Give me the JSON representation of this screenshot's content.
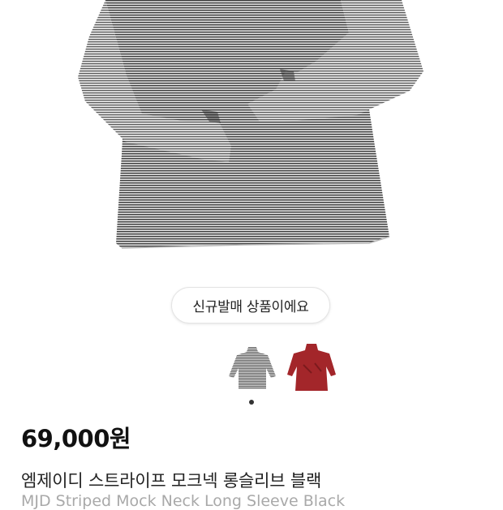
{
  "product": {
    "badge_label": "신규발매 상품이에요",
    "price": "69,000원",
    "name_ko": "엠제이디 스트라이프 모크넥 롱슬리브 블랙",
    "name_en": "MJD Striped Mock Neck Long Sleeve Black",
    "thumbnails": [
      {
        "name": "grey striped mock neck",
        "color": "#8a8a8a",
        "selected": true
      },
      {
        "name": "red mock neck",
        "color": "#a3262a",
        "selected": false
      }
    ]
  },
  "colors": {
    "stripe_dark": "#3d3d3d",
    "stripe_light": "#dcdcdc",
    "red_product": "#a3262a",
    "text_primary": "#111111",
    "text_muted": "#a9a9a9"
  }
}
